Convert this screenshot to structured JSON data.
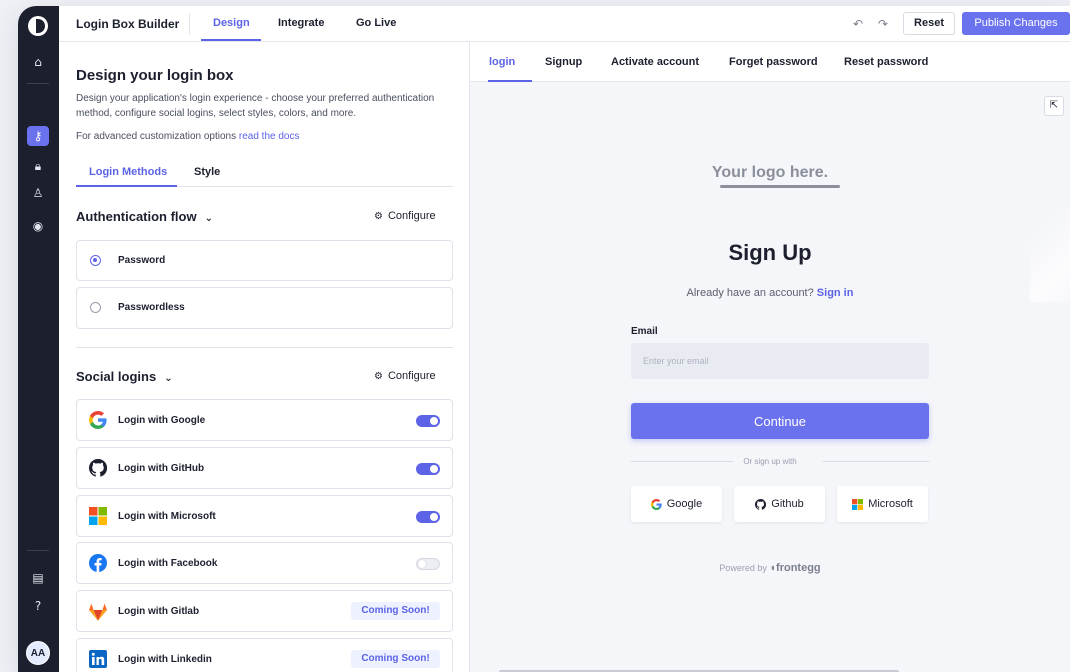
{
  "app": {
    "title": "Login Box Builder",
    "tabs": [
      "Design",
      "Integrate",
      "Go Live"
    ],
    "reset_label": "Reset",
    "publish_label": "Publish Changes",
    "avatar_initials": "AA",
    "accent_color": "#6b72ee"
  },
  "left": {
    "heading": "Design your login box",
    "description": "Design your application's login experience - choose your preferred authentication method, configure social logins, select styles, colors, and more.",
    "advanced_prefix": "For advanced customization options",
    "advanced_link": "read the docs",
    "subtabs": [
      "Login Methods",
      "Style"
    ],
    "auth": {
      "title": "Authentication flow",
      "configure": "Configure",
      "options": [
        {
          "label": "Password",
          "selected": true
        },
        {
          "label": "Passwordless",
          "selected": false
        }
      ]
    },
    "social": {
      "title": "Social logins",
      "configure": "Configure",
      "items": [
        {
          "label": "Login with Google",
          "icon": "google-icon",
          "enabled": true
        },
        {
          "label": "Login with GitHub",
          "icon": "github-icon",
          "enabled": true
        },
        {
          "label": "Login with Microsoft",
          "icon": "microsoft-icon",
          "enabled": true
        },
        {
          "label": "Login with Facebook",
          "icon": "facebook-icon",
          "enabled": false
        },
        {
          "label": "Login with Gitlab",
          "icon": "gitlab-icon",
          "badge": "Coming Soon!"
        },
        {
          "label": "Login with Linkedin",
          "icon": "linkedin-icon",
          "badge": "Coming Soon!"
        }
      ]
    }
  },
  "preview": {
    "tabs": [
      "login",
      "Signup",
      "Activate account",
      "Forget password",
      "Reset password"
    ],
    "logo_text": "Your logo here.",
    "title": "Sign Up",
    "already_text": "Already have an account?",
    "sign_in_link": "Sign in",
    "email_label": "Email",
    "email_placeholder": "Enter your email",
    "continue_label": "Continue",
    "or_text": "Or sign up with",
    "social_buttons": [
      "Google",
      "Github",
      "Microsoft"
    ],
    "powered_prefix": "Powered by",
    "powered_brand": "frontegg"
  }
}
